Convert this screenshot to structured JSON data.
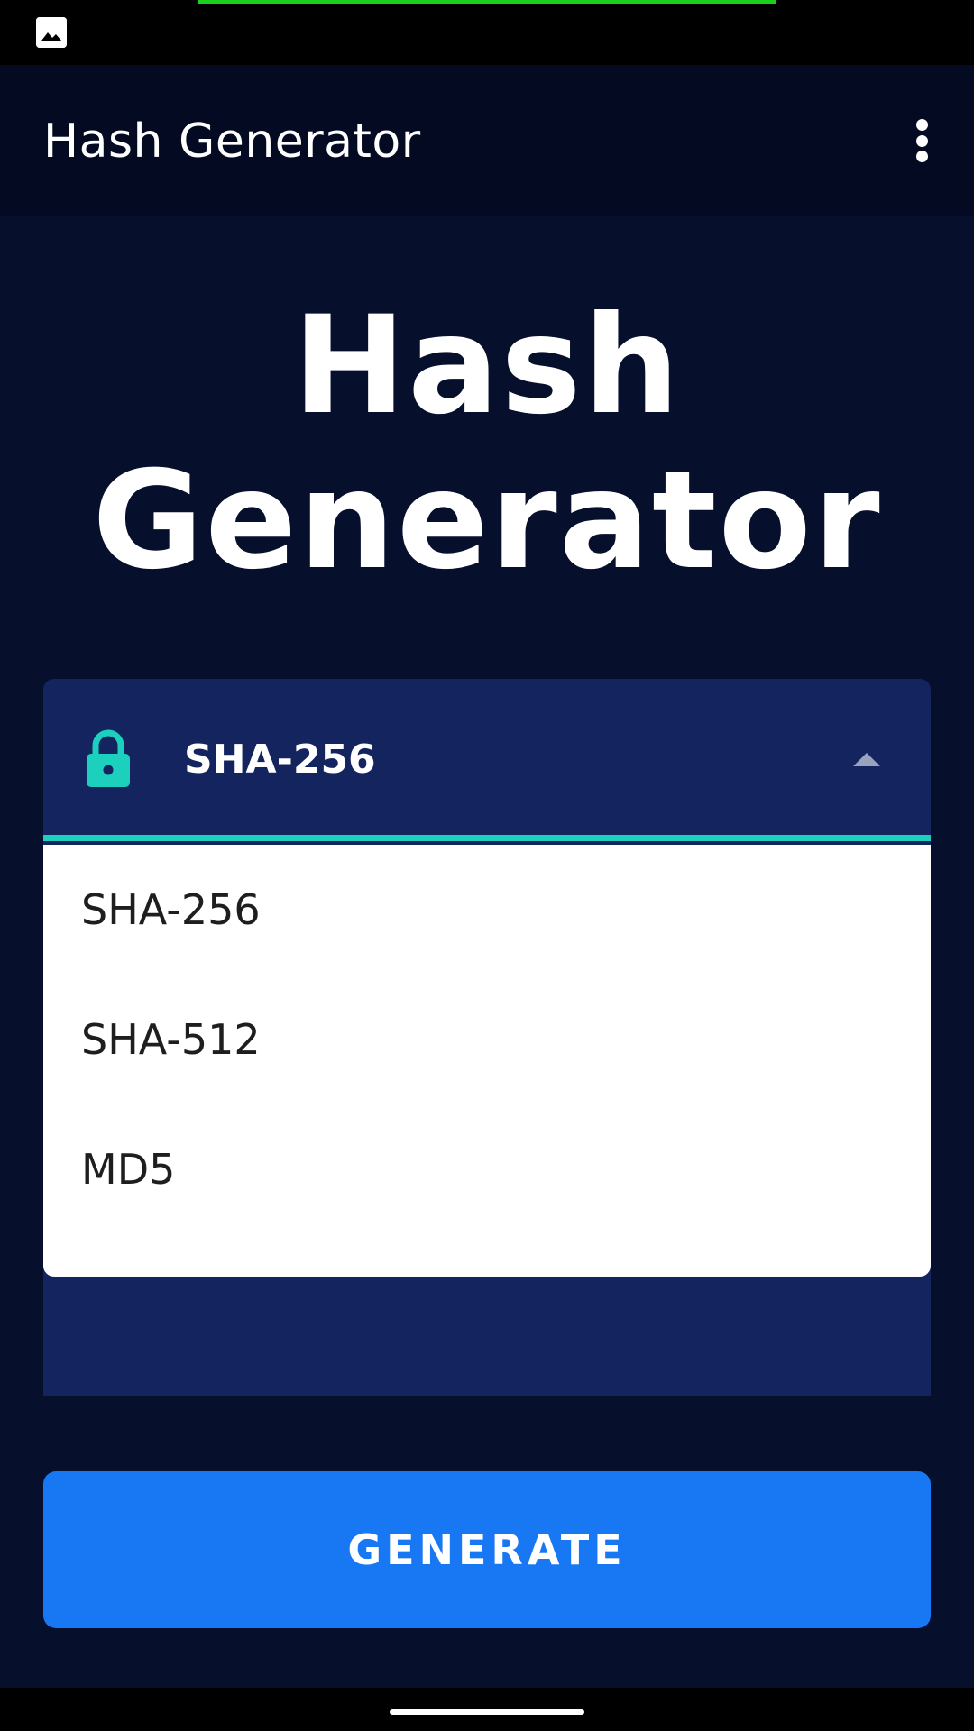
{
  "app_bar": {
    "title": "Hash Generator",
    "menu_icon": "more-vert-icon"
  },
  "hero": {
    "line1": "Hash",
    "line2": "Generator"
  },
  "algorithm_select": {
    "selected": "SHA-256",
    "icon": "lock-icon",
    "accent_color": "#1dcfbd",
    "expanded": true,
    "options": [
      "SHA-256",
      "SHA-512",
      "MD5"
    ]
  },
  "generate_button": {
    "label": "GENERATE",
    "color": "#1877f2"
  },
  "colors": {
    "background": "#060f2b",
    "card": "#14245e",
    "status_progress": "#1ad01a"
  }
}
